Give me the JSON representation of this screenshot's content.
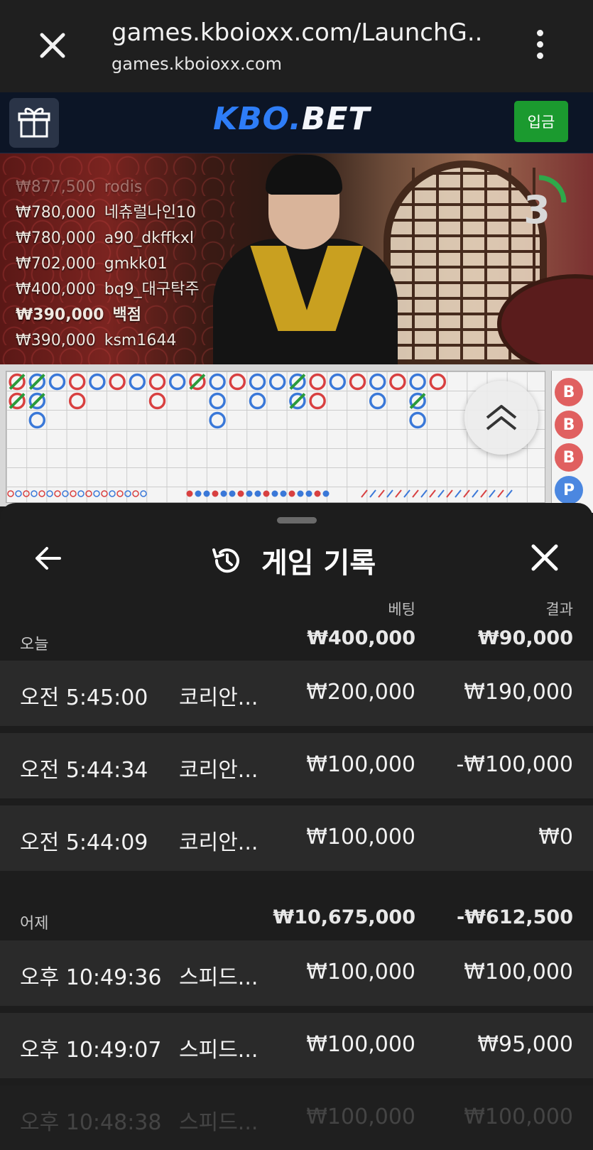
{
  "browser": {
    "url": "games.kboioxx.com/LaunchG...",
    "domain": "games.kboioxx.com"
  },
  "site": {
    "logo_kbo": "KBO",
    "logo_dot": ".",
    "logo_bet": "BET",
    "deposit_label": "입금"
  },
  "video": {
    "countdown": "3",
    "winners": [
      {
        "amount": "₩877,500",
        "name": "rodis"
      },
      {
        "amount": "₩780,000",
        "name": "네츄럴나인10"
      },
      {
        "amount": "₩780,000",
        "name": "a90_dkffkxl"
      },
      {
        "amount": "₩702,000",
        "name": "gmkk01"
      },
      {
        "amount": "₩400,000",
        "name": "bq9_대구탁주"
      },
      {
        "amount": "₩390,000",
        "name": "백점"
      },
      {
        "amount": "₩390,000",
        "name": "ksm1644"
      }
    ]
  },
  "bead_road": [
    "B",
    "B",
    "B",
    "P"
  ],
  "panel": {
    "title": "게임 기록",
    "col_bet": "베팅",
    "col_result": "결과",
    "groups": [
      {
        "label": "오늘",
        "bet_total": "₩400,000",
        "result_total": "₩90,000",
        "rows": [
          {
            "time": "오전 5:45:00",
            "game": "코리안...",
            "bet": "₩200,000",
            "result": "₩190,000"
          },
          {
            "time": "오전 5:44:34",
            "game": "코리안...",
            "bet": "₩100,000",
            "result": "-₩100,000"
          },
          {
            "time": "오전 5:44:09",
            "game": "코리안...",
            "bet": "₩100,000",
            "result": "₩0"
          }
        ]
      },
      {
        "label": "어제",
        "bet_total": "₩10,675,000",
        "result_total": "-₩612,500",
        "rows": [
          {
            "time": "오후 10:49:36",
            "game": "스피드...",
            "bet": "₩100,000",
            "result": "₩100,000"
          },
          {
            "time": "오후 10:49:07",
            "game": "스피드...",
            "bet": "₩100,000",
            "result": "₩95,000"
          },
          {
            "time": "오후 10:48:38",
            "game": "스피드...",
            "bet": "₩100,000",
            "result": "₩100,000"
          }
        ]
      }
    ]
  },
  "colors": {
    "banker": "#d84040",
    "player": "#3a78d8",
    "tie": "#2a9a3a",
    "deposit": "#1b9a2f",
    "logo_blue": "#2e7df7"
  },
  "icons": {
    "browser_close": "close-icon",
    "browser_menu": "more-vert-icon",
    "gift": "gift-icon",
    "back": "arrow-left-icon",
    "history": "history-icon",
    "panel_close": "close-icon",
    "scroll_up": "double-chevron-up-icon"
  }
}
